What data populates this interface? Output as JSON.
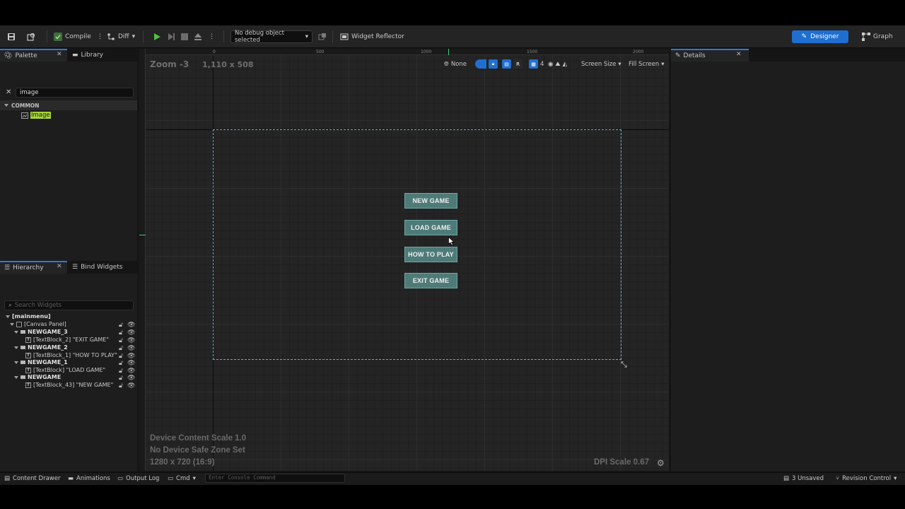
{
  "toolbar": {
    "compile_label": "Compile",
    "diff_label": "Diff",
    "debug_object": "No debug object selected",
    "widget_reflector_label": "Widget Reflector",
    "designer_label": "Designer",
    "graph_label": "Graph"
  },
  "palette": {
    "tab_palette": "Palette",
    "tab_library": "Library",
    "search_value": "image",
    "category": "COMMON",
    "item": "Image"
  },
  "hierarchy": {
    "tab_hierarchy": "Hierarchy",
    "tab_bind_widgets": "Bind Widgets",
    "search_placeholder": "Search Widgets",
    "rows": [
      "[mainmenu]",
      "[Canvas Panel]",
      "NEWGAME_3",
      "[TextBlock_2] \"EXIT GAME\"",
      "NEWGAME_2",
      "[TextBlock_1] \"HOW TO PLAY\"",
      "NEWGAME_1",
      "[TextBlock] \"LOAD GAME\"",
      "NEWGAME",
      "[TextBlock_43] \"NEW GAME\""
    ]
  },
  "details": {
    "tab_label": "Details"
  },
  "viewport": {
    "zoom": "Zoom -3",
    "resolution": "1,110 x 508",
    "ruler_top": [
      "0",
      "500",
      "1000",
      "1500",
      "2000"
    ],
    "none_label": "None",
    "r_label": "R",
    "grid_value": "4",
    "screen_size_label": "Screen Size",
    "fill_screen_label": "Fill Screen",
    "device_content_scale": "Device Content Scale 1.0",
    "safe_zone": "No Device Safe Zone Set",
    "screen_res": "1280 x 720 (16:9)",
    "dpi_scale": "DPI Scale 0.67"
  },
  "menu_buttons": [
    "NEW GAME",
    "LOAD GAME",
    "HOW TO PLAY",
    "EXIT GAME"
  ],
  "statusbar": {
    "content_drawer": "Content Drawer",
    "animations": "Animations",
    "output_log": "Output Log",
    "cmd": "Cmd",
    "console_placeholder": "Enter Console Command",
    "unsaved": "3 Unsaved",
    "revision_control": "Revision Control"
  }
}
